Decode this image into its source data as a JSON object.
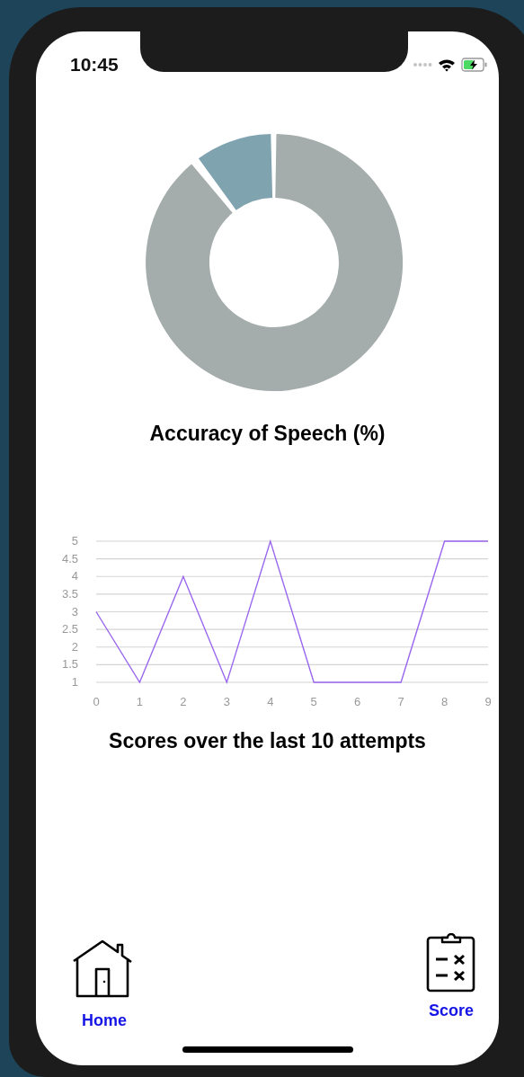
{
  "status_bar": {
    "time": "10:45"
  },
  "accuracy_chart": {
    "title": "Accuracy of Speech (%)"
  },
  "scores_chart": {
    "title": "Scores over the last 10 attempts",
    "chart_data": {
      "type": "line",
      "categories": [
        "0",
        "1",
        "2",
        "3",
        "4",
        "5",
        "6",
        "7",
        "8",
        "9"
      ],
      "series": [
        {
          "color": "#9966ee",
          "values": [
            3,
            1,
            4,
            1,
            5,
            1,
            1,
            1,
            5,
            5
          ]
        }
      ],
      "ylim": [
        1,
        5
      ],
      "yticks": [
        1,
        1.5,
        2,
        2.5,
        3,
        3.5,
        4,
        4.5,
        5
      ],
      "grid": true
    }
  },
  "tab_bar": {
    "tabs": [
      {
        "label": "Home",
        "kind": "home"
      },
      {
        "label": "Score",
        "kind": "score"
      }
    ]
  }
}
